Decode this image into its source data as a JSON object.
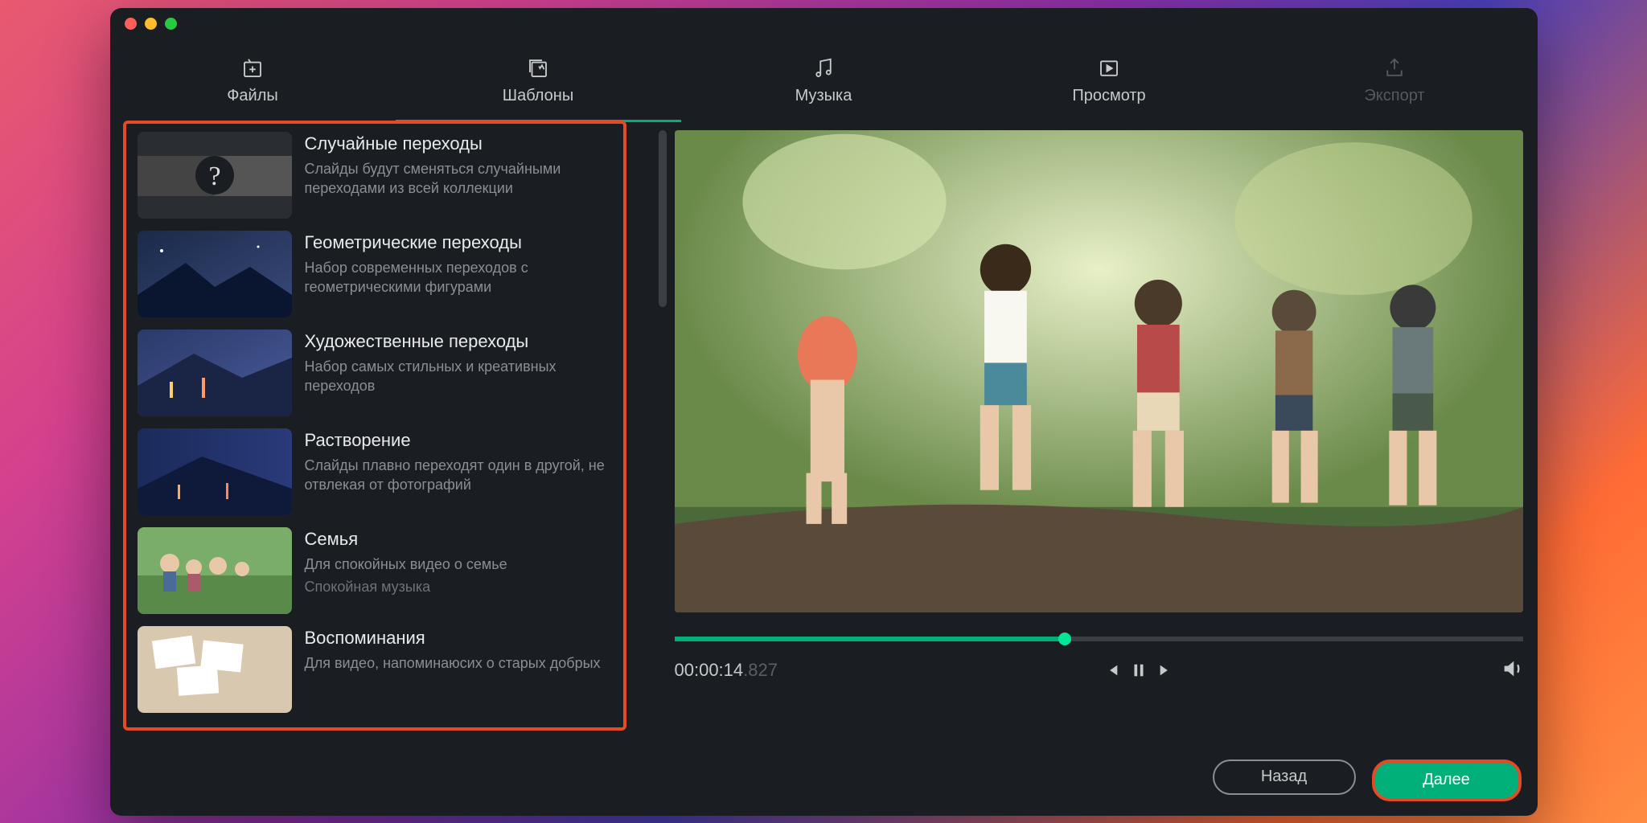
{
  "tabs": {
    "files": "Файлы",
    "templates": "Шаблоны",
    "music": "Музыка",
    "preview": "Просмотр",
    "export": "Экспорт"
  },
  "templates": [
    {
      "title": "Случайные переходы",
      "desc": "Слайды будут сменяться случайными переходами из всей коллекции",
      "sub": ""
    },
    {
      "title": "Геометрические переходы",
      "desc": "Набор современных переходов с геометрическими фигурами",
      "sub": ""
    },
    {
      "title": "Художественные переходы",
      "desc": "Набор самых стильных и креативных переходов",
      "sub": ""
    },
    {
      "title": "Растворение",
      "desc": "Слайды плавно переходят один в другой, не отвлекая от фотографий",
      "sub": ""
    },
    {
      "title": "Семья",
      "desc": "Для спокойных видео о семье",
      "sub": "Спокойная музыка"
    },
    {
      "title": "Воспоминания",
      "desc": "Для видео, напоминаюсих о старых добрых",
      "sub": ""
    }
  ],
  "playback": {
    "timecode_main": "00:00:14",
    "timecode_ms": ".827",
    "progress_percent": 46
  },
  "buttons": {
    "back": "Назад",
    "next": "Далее"
  }
}
